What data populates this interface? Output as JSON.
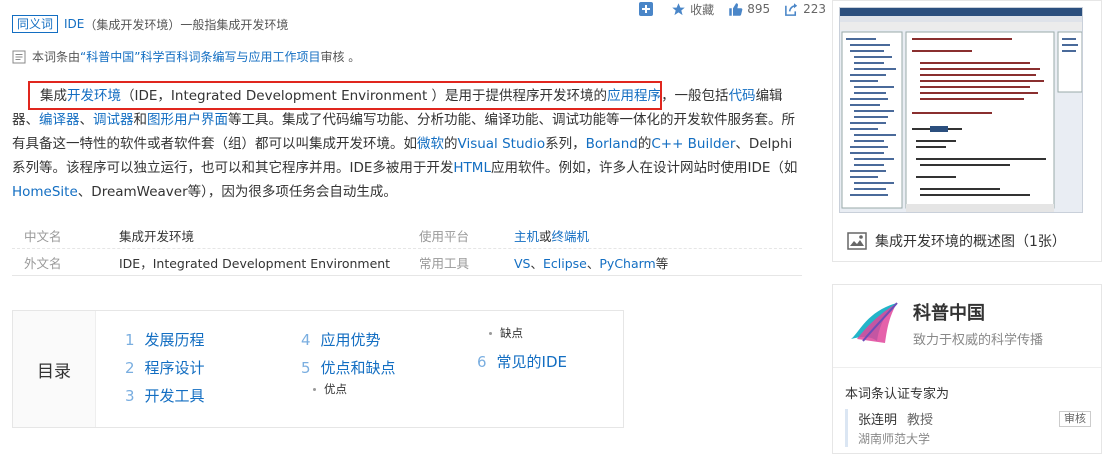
{
  "synonym": {
    "tag": "同义词",
    "text_link": "IDE",
    "text_rest": "（集成开发环境）一般指集成开发环境"
  },
  "toolbar": {
    "favorite": "收藏",
    "likes": "895",
    "shares": "223"
  },
  "certify": {
    "prefix": "本词条由",
    "org": "“科普中国”科学百科词条编写与应用工作项目",
    "suffix": " 审核 。"
  },
  "summary": {
    "parts": [
      {
        "t": "集成",
        "link": false
      },
      {
        "t": "开发环境",
        "link": true
      },
      {
        "t": "（IDE，Integrated Development Environment ）是用于提供程序开发环境的",
        "link": false
      },
      {
        "t": "应用程序",
        "link": true
      },
      {
        "t": "，一般包括",
        "link": false
      },
      {
        "t": "代码",
        "link": true
      },
      {
        "t": "编辑器、",
        "link": false
      },
      {
        "t": "编译器",
        "link": true
      },
      {
        "t": "、",
        "link": false
      },
      {
        "t": "调试器",
        "link": true
      },
      {
        "t": "和",
        "link": false
      },
      {
        "t": "图形用户界面",
        "link": true
      },
      {
        "t": "等工具。集成了代码编写功能、分析功能、编译功能、调试功能等一体化的开发软件服务套。所有具备这一特性的软件或者软件套（组）都可以叫集成开发环境。如",
        "link": false
      },
      {
        "t": "微软",
        "link": true
      },
      {
        "t": "的",
        "link": false
      },
      {
        "t": "Visual Studio",
        "link": true
      },
      {
        "t": "系列，",
        "link": false
      },
      {
        "t": "Borland",
        "link": true
      },
      {
        "t": "的",
        "link": false
      },
      {
        "t": "C++ Builder",
        "link": true
      },
      {
        "t": "、Delphi系列等。该程序可以独立运行，也可以和其它程序并用。IDE多被用于开发",
        "link": false
      },
      {
        "t": "HTML",
        "link": true
      },
      {
        "t": "应用软件。例如，许多人在设计网站时使用IDE（如",
        "link": false
      },
      {
        "t": "HomeSite",
        "link": true
      },
      {
        "t": "、DreamWeaver等），因为很多项任务会自动生成。",
        "link": false
      }
    ]
  },
  "info": {
    "rows": [
      {
        "k1": "中文名",
        "v1": "集成开发环境",
        "k2": "使用平台",
        "v2_parts": [
          {
            "t": "主机",
            "link": true
          },
          {
            "t": "或",
            "link": false
          },
          {
            "t": "终端机",
            "link": true
          }
        ]
      },
      {
        "k1": "外文名",
        "v1": "IDE，Integrated Development Environment",
        "k2": "常用工具",
        "v2_parts": [
          {
            "t": "VS",
            "link": true
          },
          {
            "t": "、",
            "link": false
          },
          {
            "t": "Eclipse",
            "link": true
          },
          {
            "t": "、",
            "link": false
          },
          {
            "t": "PyCharm",
            "link": true
          },
          {
            "t": "等",
            "link": false
          }
        ]
      }
    ]
  },
  "catalog": {
    "title": "目录",
    "items": [
      {
        "num": "1",
        "label": "发展历程"
      },
      {
        "num": "2",
        "label": "程序设计"
      },
      {
        "num": "3",
        "label": "开发工具"
      },
      {
        "num": "4",
        "label": "应用优势"
      },
      {
        "num": "5",
        "label": "优点和缺点"
      },
      {
        "num": "6",
        "label": "常见的IDE"
      }
    ],
    "subs": [
      "优点",
      "缺点"
    ]
  },
  "album": {
    "caption": "集成开发环境的概述图（1张）"
  },
  "kepu": {
    "brand": "科普中国",
    "slogan": "致力于权威的科学传播",
    "expert_title": "本词条认证专家为",
    "expert": {
      "name": "张连明",
      "title": "教授",
      "org": "湖南师范大学",
      "badge": "审核"
    }
  },
  "colors": {
    "link": "#136ec2",
    "highlight_box": "#e0261e"
  }
}
